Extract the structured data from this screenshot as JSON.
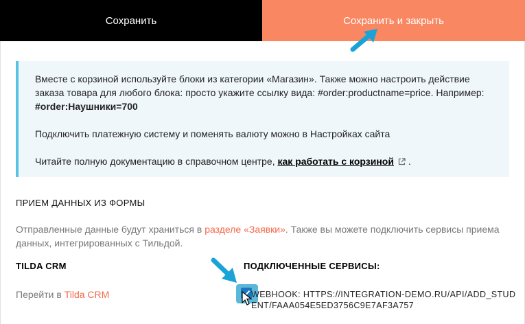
{
  "toolbar": {
    "save_label": "Сохранить",
    "save_close_label": "Сохранить и закрыть"
  },
  "info": {
    "line1_a": "Вместе с корзиной используйте блоки из категории «Магазин». Также можно настроить действие заказа товара для любого блока: просто укажите ссылку вида: #order:productname=price. Например: ",
    "line1_example": "#order:Наушники=700",
    "line2": "Подключить платежную систему и поменять валюту можно в Настройках сайта",
    "line3_a": "Читайте полную документацию в справочном центре, ",
    "line3_link": "как работать с корзиной",
    "line3_end": "."
  },
  "form_section": {
    "title": "ПРИЕМ ДАННЫХ ИЗ ФОРМЫ",
    "desc_a": "Отправленные данные будут храниться в ",
    "desc_link": "разделе «Заявки»",
    "desc_b": ". Также вы можете подключить сервисы приема данных, интегрированных с Тильдой."
  },
  "crm": {
    "title": "TILDA CRM",
    "text_a": "Перейти в ",
    "link": "Tilda CRM"
  },
  "services": {
    "title": "ПОДКЛЮЧЕННЫЕ СЕРВИСЫ:",
    "webhook_label": "WEBHOOK: HTTPS://INTEGRATION-DEMO.RU/API/ADD_STUDENT/FAAA054E5ED3756C9E7AF3A757",
    "webhook_checked": true
  },
  "icons": {
    "external": "external-link-icon",
    "checkbox": "checkmark-icon",
    "pointer": "cursor-icon",
    "annotation_arrow": "arrow-icon"
  },
  "colors": {
    "accent": "#f98762",
    "link": "#f4694a",
    "info_border": "#58c2e5",
    "info_bg": "#f0f7fb",
    "arrow": "#1aa3d6"
  }
}
